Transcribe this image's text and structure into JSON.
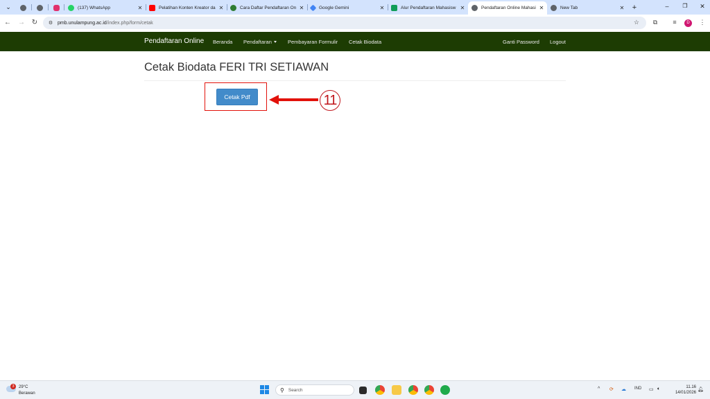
{
  "browser": {
    "tabs": [
      {
        "title": "",
        "icon": "globe-icon",
        "color": "#5f6368"
      },
      {
        "title": "",
        "icon": "globe-icon",
        "color": "#5f6368"
      },
      {
        "title": "",
        "icon": "instagram-icon",
        "color": "#e1306c"
      },
      {
        "title": "(137) WhatsApp",
        "icon": "whatsapp-icon",
        "color": "#25d366"
      },
      {
        "title": "Pelatihan Konten Kreator da",
        "icon": "youtube-icon",
        "color": "#ff0000"
      },
      {
        "title": "Cara Daftar Pendaftaran On",
        "icon": "site-icon",
        "color": "#2e7d32"
      },
      {
        "title": "Google Gemini",
        "icon": "gemini-icon",
        "color": "#4285f4"
      },
      {
        "title": "Alur Pendaftaran Mahasisw",
        "icon": "sheets-icon",
        "color": "#0f9d58"
      },
      {
        "title": "Pendaftaran Online Mahasi",
        "icon": "globe-icon",
        "color": "#5f6368",
        "active": true
      },
      {
        "title": "New Tab",
        "icon": "chrome-icon",
        "color": "#5f6368"
      }
    ],
    "address": {
      "host": "pmb.unulampung.ac.id",
      "path": "/index.php/form/cetak"
    },
    "profile_initial": "D"
  },
  "navbar": {
    "brand": "Pendaftaran Online",
    "items": [
      "Beranda",
      "Pendaftaran",
      "Pembayaran Formulir",
      "Cetak Biodata"
    ],
    "right_items": [
      "Ganti Password",
      "Logout"
    ],
    "background": "#1d3c03"
  },
  "page": {
    "title": "Cetak Biodata FERI TRI SETIAWAN",
    "print_button": "Cetak Pdf",
    "step_number": "11",
    "accent": "#428bca"
  },
  "taskbar": {
    "weather": {
      "badge": "3",
      "temp": "29°C",
      "condition": "Berawan"
    },
    "search_placeholder": "Search",
    "lang": "IND",
    "time": "11.16",
    "date": "14/01/2026"
  }
}
